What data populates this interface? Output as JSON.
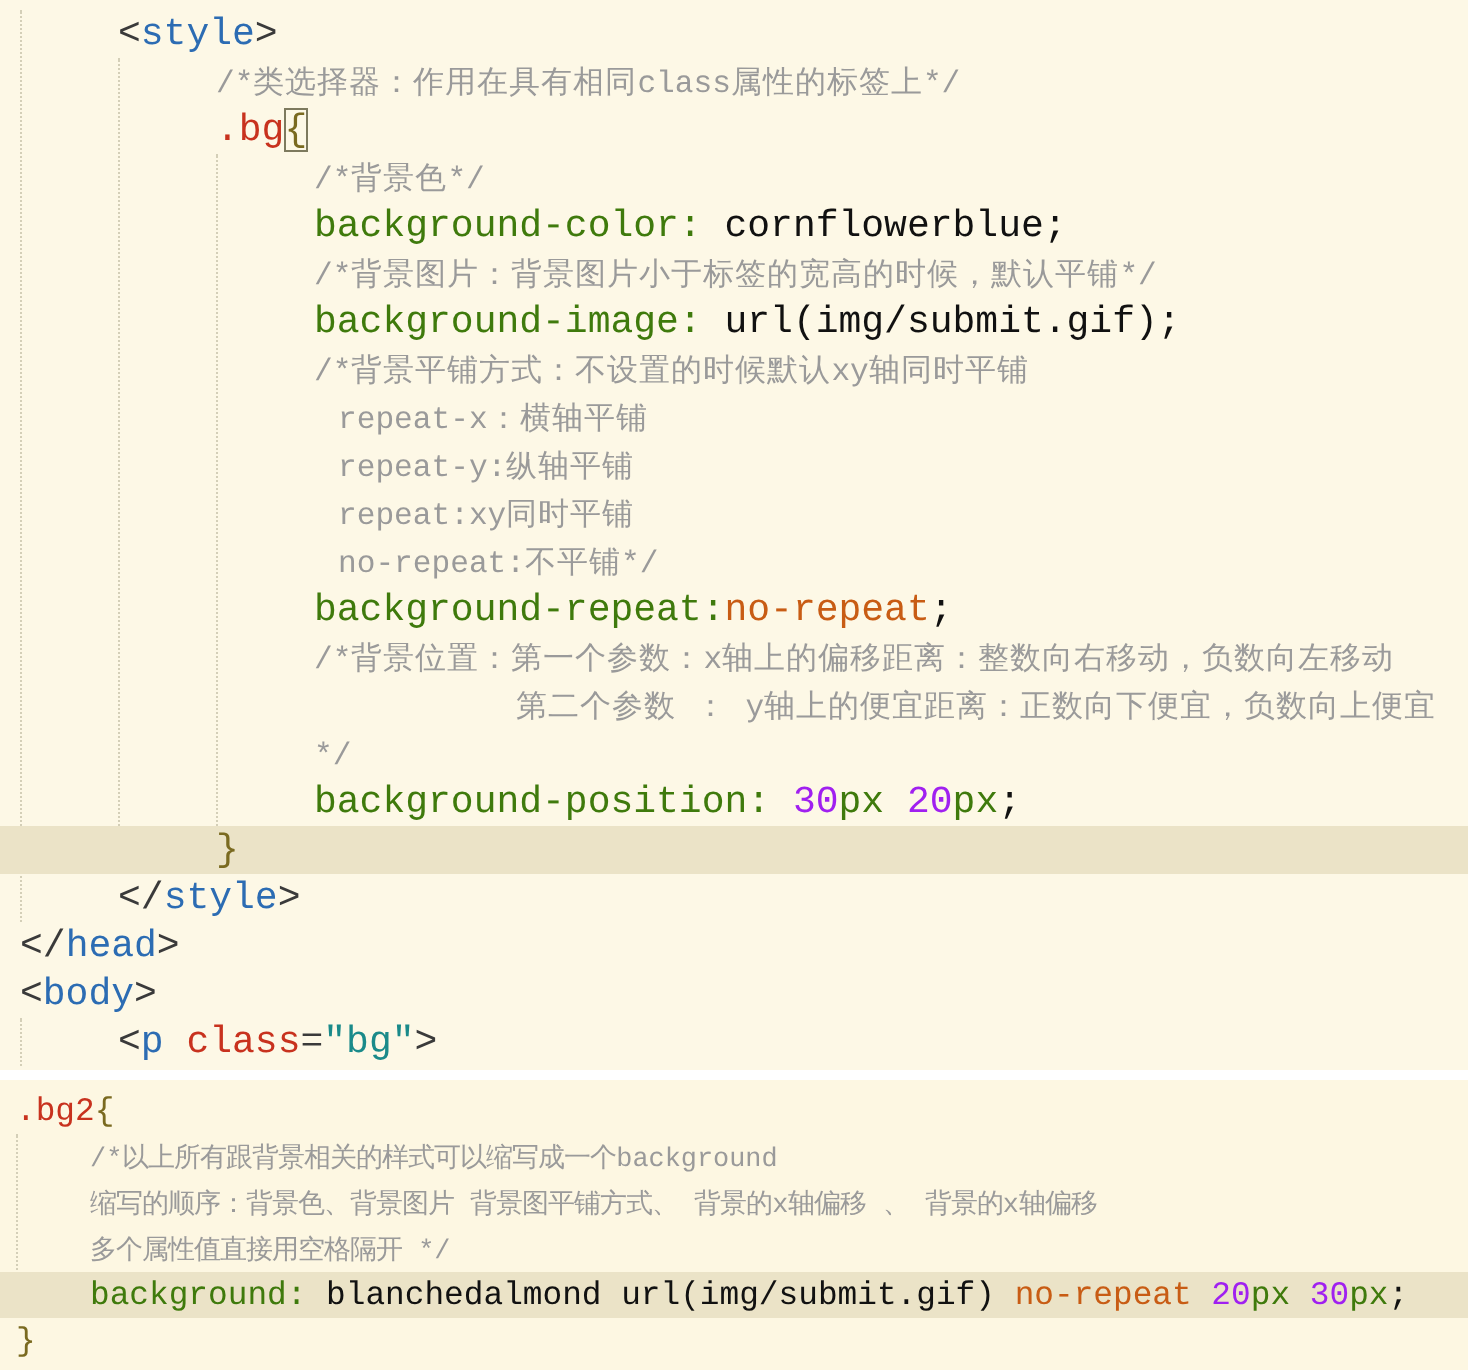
{
  "panels": [
    {
      "kind": "large",
      "lines": [
        {
          "children": [
            {
              "kind": "code",
              "current": false,
              "tokens": [
                {
                  "kind": "punct",
                  "text": "<"
                },
                {
                  "kind": "tag",
                  "text": "style"
                },
                {
                  "kind": "punct",
                  "text": ">"
                }
              ],
              "children": [
                {
                  "kind": "code",
                  "current": false,
                  "tokens": [
                    {
                      "kind": "comment",
                      "text": "/*类选择器：作用在具有相同class属性的标签上*/"
                    }
                  ]
                },
                {
                  "kind": "code",
                  "current": false,
                  "tokens": [
                    {
                      "kind": "selector",
                      "text": ".bg"
                    },
                    {
                      "kind": "brace-match",
                      "text": "{"
                    }
                  ],
                  "children": [
                    {
                      "kind": "code",
                      "current": false,
                      "tokens": [
                        {
                          "kind": "comment",
                          "text": "/*背景色*/"
                        }
                      ]
                    },
                    {
                      "kind": "code",
                      "current": false,
                      "tokens": [
                        {
                          "kind": "property",
                          "text": "background-color:"
                        },
                        {
                          "kind": "value",
                          "text": " cornflowerblue;"
                        }
                      ]
                    },
                    {
                      "kind": "code",
                      "current": false,
                      "tokens": [
                        {
                          "kind": "comment",
                          "text": "/*背景图片：背景图片小于标签的宽高的时候，默认平铺*/"
                        }
                      ]
                    },
                    {
                      "kind": "code",
                      "current": false,
                      "tokens": [
                        {
                          "kind": "property",
                          "text": "background-image:"
                        },
                        {
                          "kind": "value",
                          "text": " url(img/submit.gif);"
                        }
                      ]
                    },
                    {
                      "kind": "code",
                      "current": false,
                      "tokens": [
                        {
                          "kind": "comment",
                          "text": "/*背景平铺方式：不设置的时候默认xy轴同时平铺"
                        }
                      ]
                    },
                    {
                      "kind": "continuation",
                      "current": false,
                      "tokens": [
                        {
                          "kind": "comment",
                          "text": "repeat-x：横轴平铺"
                        }
                      ]
                    },
                    {
                      "kind": "continuation",
                      "current": false,
                      "tokens": [
                        {
                          "kind": "comment",
                          "text": "repeat-y:纵轴平铺"
                        }
                      ]
                    },
                    {
                      "kind": "continuation",
                      "current": false,
                      "tokens": [
                        {
                          "kind": "comment",
                          "text": "repeat:xy同时平铺"
                        }
                      ]
                    },
                    {
                      "kind": "continuation",
                      "current": false,
                      "tokens": [
                        {
                          "kind": "comment",
                          "text": "no-repeat:不平铺*/"
                        }
                      ]
                    },
                    {
                      "kind": "code",
                      "current": false,
                      "tokens": [
                        {
                          "kind": "property",
                          "text": "background-repeat:"
                        },
                        {
                          "kind": "keyword",
                          "text": "no-repeat"
                        },
                        {
                          "kind": "value",
                          "text": ";"
                        }
                      ]
                    },
                    {
                      "kind": "code",
                      "current": false,
                      "tokens": [
                        {
                          "kind": "comment",
                          "text": "/*背景位置：第一个参数：x轴上的偏移距离：整数向右移动，负数向左移动"
                        }
                      ]
                    },
                    {
                      "kind": "aligned",
                      "current": false,
                      "tokens": [
                        {
                          "kind": "comment",
                          "text": "第二个参数 ： y轴上的便宜距离：正数向下便宜，负数向上便宜"
                        }
                      ]
                    },
                    {
                      "kind": "code",
                      "current": false,
                      "tokens": [
                        {
                          "kind": "comment",
                          "text": "*/"
                        }
                      ]
                    },
                    {
                      "kind": "code",
                      "current": false,
                      "tokens": [
                        {
                          "kind": "property",
                          "text": "background-position:"
                        },
                        {
                          "kind": "number",
                          "text": " 30"
                        },
                        {
                          "kind": "unit",
                          "text": "px"
                        },
                        {
                          "kind": "number",
                          "text": " 20"
                        },
                        {
                          "kind": "unit",
                          "text": "px"
                        },
                        {
                          "kind": "value",
                          "text": ";"
                        }
                      ]
                    }
                  ]
                },
                {
                  "kind": "code",
                  "current": true,
                  "tokens": [
                    {
                      "kind": "brace",
                      "text": "}"
                    }
                  ]
                }
              ]
            },
            {
              "kind": "code",
              "current": false,
              "tokens": [
                {
                  "kind": "punct",
                  "text": "</"
                },
                {
                  "kind": "tag",
                  "text": "style"
                },
                {
                  "kind": "punct",
                  "text": ">"
                }
              ]
            }
          ]
        },
        {
          "kind": "code",
          "current": false,
          "tokens": [
            {
              "kind": "punct",
              "text": "</"
            },
            {
              "kind": "tag",
              "text": "head"
            },
            {
              "kind": "punct",
              "text": ">"
            }
          ]
        },
        {
          "kind": "code",
          "current": false,
          "tokens": [
            {
              "kind": "punct",
              "text": "<"
            },
            {
              "kind": "tag",
              "text": "body"
            },
            {
              "kind": "punct",
              "text": ">"
            }
          ],
          "children": [
            {
              "kind": "code",
              "current": false,
              "tokens": [
                {
                  "kind": "punct",
                  "text": "<"
                },
                {
                  "kind": "tag",
                  "text": "p"
                },
                {
                  "kind": "attr",
                  "text": " class"
                },
                {
                  "kind": "punct",
                  "text": "="
                },
                {
                  "kind": "string",
                  "text": "\"bg\""
                },
                {
                  "kind": "punct",
                  "text": ">"
                }
              ]
            }
          ]
        }
      ]
    },
    {
      "kind": "small",
      "lines": [
        {
          "kind": "code",
          "current": false,
          "tokens": [
            {
              "kind": "selector",
              "text": ".bg2"
            },
            {
              "kind": "brace",
              "text": "{"
            }
          ],
          "children": [
            {
              "kind": "code",
              "current": false,
              "tokens": [
                {
                  "kind": "comment",
                  "text": "/*以上所有跟背景相关的样式可以缩写成一个background"
                }
              ]
            },
            {
              "kind": "code",
              "current": false,
              "tokens": [
                {
                  "kind": "comment",
                  "text": "缩写的顺序：背景色、背景图片 背景图平铺方式、 背景的x轴偏移 、 背景的x轴偏移"
                }
              ]
            },
            {
              "kind": "code",
              "current": false,
              "tokens": [
                {
                  "kind": "comment",
                  "text": "多个属性值直接用空格隔开 */"
                }
              ]
            },
            {
              "kind": "code",
              "current": true,
              "tokens": [
                {
                  "kind": "property",
                  "text": "background:"
                },
                {
                  "kind": "value",
                  "text": " blanchedalmond url(img/submit.gif) "
                },
                {
                  "kind": "keyword",
                  "text": "no-repeat"
                },
                {
                  "kind": "number",
                  "text": " 20"
                },
                {
                  "kind": "unit",
                  "text": "px"
                },
                {
                  "kind": "number",
                  "text": " 30"
                },
                {
                  "kind": "unit",
                  "text": "px"
                },
                {
                  "kind": "value",
                  "text": ";"
                }
              ]
            }
          ]
        },
        {
          "kind": "code",
          "current": false,
          "tokens": [
            {
              "kind": "brace",
              "text": "}"
            }
          ]
        }
      ]
    }
  ]
}
